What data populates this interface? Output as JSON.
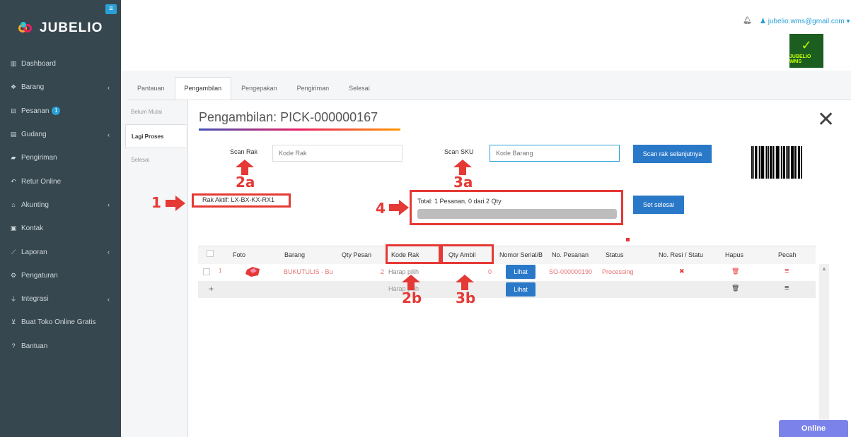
{
  "brand": {
    "name": "JUBELIO",
    "wms_label": "JUBELIO WMS"
  },
  "header": {
    "user_email": "jubelio.wms@gmail.com"
  },
  "sidebar": {
    "items": [
      {
        "label": "Dashboard",
        "icon": "chart-icon"
      },
      {
        "label": "Barang",
        "icon": "cubes-icon"
      },
      {
        "label": "Pesanan",
        "icon": "basket-icon",
        "badge": "1"
      },
      {
        "label": "Gudang",
        "icon": "building-icon"
      },
      {
        "label": "Pengiriman",
        "icon": "truck-icon"
      },
      {
        "label": "Retur Online",
        "icon": "reply-icon"
      },
      {
        "label": "Akunting",
        "icon": "bank-icon"
      },
      {
        "label": "Kontak",
        "icon": "contact-card-icon"
      },
      {
        "label": "Laporan",
        "icon": "line-chart-icon"
      },
      {
        "label": "Pengaturan",
        "icon": "cogs-icon"
      },
      {
        "label": "Integrasi",
        "icon": "plug-icon"
      },
      {
        "label": "Buat Toko Online Gratis",
        "icon": "cart-icon"
      },
      {
        "label": "Bantuan",
        "icon": "question-icon"
      }
    ]
  },
  "tabs": [
    "Pantauan",
    "Pengambilan",
    "Pengepakan",
    "Pengiriman",
    "Selesai"
  ],
  "substatus": [
    "Belum Mulai",
    "Lagi Proses",
    "Selesai"
  ],
  "modal": {
    "title": "Pengambilan: PICK-000000167",
    "scan_rak_label": "Scan Rak",
    "scan_rak_placeholder": "Kode Rak",
    "scan_sku_label": "Scan SKU",
    "scan_sku_placeholder": "Kode Barang",
    "next_rack_button": "Scan rak selanjutnya",
    "rak_aktif": "Rak Aktif: LX-BX-KX-RX1",
    "total": "Total: 1 Pesanan, 0 dari 2 Qty",
    "set_done_button": "Set selesai",
    "progress": 0
  },
  "annotations": {
    "n1": "1",
    "n2a": "2a",
    "n3a": "3a",
    "n4": "4",
    "n2b": "2b",
    "n3b": "3b"
  },
  "table": {
    "headers": [
      "Foto",
      "Barang",
      "Qty Pesan",
      "Kode Rak",
      "Qty Ambil",
      "Nomor Serial/B",
      "No. Pesanan",
      "Status",
      "No. Resi / Statu",
      "Hapus",
      "Pecah"
    ],
    "row1": {
      "num": "1",
      "barang": "BUKUTULIS - Bu",
      "qty_pesan": "2",
      "kode_rak": "Harap pilih",
      "qty_ambil": "0",
      "lihat": "Lihat",
      "no_pesanan": "SO-000000190",
      "status": "Processing"
    },
    "row2": {
      "add": "+",
      "kode_rak": "Harap pilih",
      "lihat": "Lihat"
    }
  },
  "online_label": "Online",
  "colors": {
    "sidebar": "#37474f",
    "accent": "#2a79c9",
    "annotation": "#e53935"
  }
}
